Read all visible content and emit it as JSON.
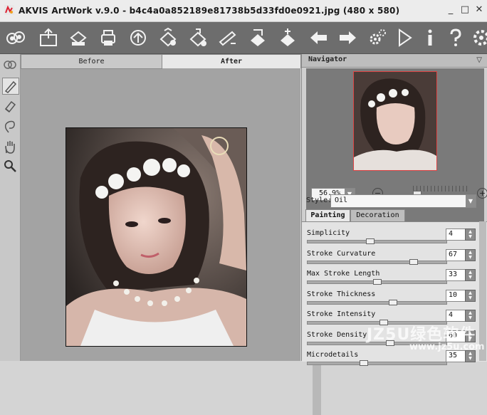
{
  "window": {
    "title": "AKVIS ArtWork v.9.0 - b4c4a0a852189e81738b5d33fd0e0921.jpg (480 x 580)",
    "minimize_glyph": "_",
    "maximize_glyph": "□",
    "close_glyph": "✕"
  },
  "toolbar": {
    "icons": [
      "open-image-icon",
      "save-icon",
      "print-icon",
      "share-icon",
      "batch-icon",
      "presets-icon",
      "stroke-icon",
      "brush-presets-icon",
      "canvas-icon",
      "undo-icon",
      "redo-icon",
      "settings-icon",
      "run-icon",
      "info-icon",
      "help-icon",
      "preferences-icon"
    ]
  },
  "canvas": {
    "tab_before": "Before",
    "tab_after": "After"
  },
  "navigator": {
    "title": "Navigator",
    "collapse_glyph": "▽",
    "zoom_value": "56.9%",
    "zoom_minus": "−",
    "zoom_plus": "+"
  },
  "settings": {
    "style_label": "Style:",
    "style_value": "Oil",
    "tab_painting": "Painting",
    "tab_decoration": "Decoration",
    "params": [
      {
        "label": "Simplicity",
        "value": "4",
        "level": 0.45
      },
      {
        "label": "Stroke Curvature",
        "value": "67",
        "level": 0.78
      },
      {
        "label": "Max Stroke Length",
        "value": "33",
        "level": 0.5
      },
      {
        "label": "Stroke Thickness",
        "value": "10",
        "level": 0.62
      },
      {
        "label": "Stroke Intensity",
        "value": "4",
        "level": 0.55
      },
      {
        "label": "Stroke Density",
        "value": "60",
        "level": 0.6
      },
      {
        "label": "Microdetails",
        "value": "35",
        "level": 0.4
      }
    ]
  },
  "watermark": {
    "text": "JZ5U绿色软件",
    "url": "www.jz5u.com"
  },
  "colors": {
    "toolbar_bg": "#6d6d6d",
    "canvas_bg": "#a3a3a3",
    "panel_bg": "#cfcfcf"
  }
}
